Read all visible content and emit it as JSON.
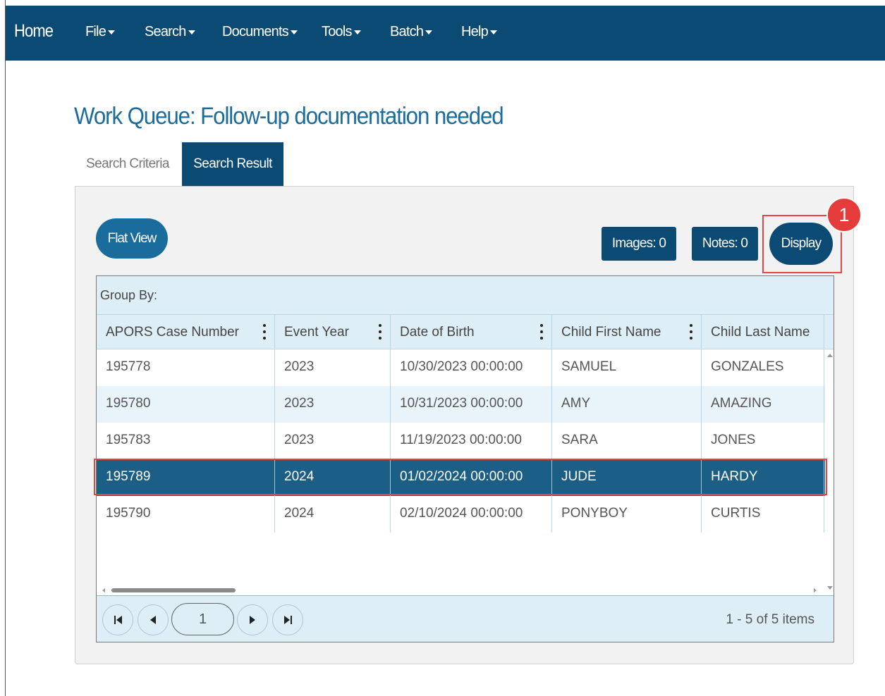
{
  "nav": {
    "home": "Home",
    "items": [
      "File",
      "Search",
      "Documents",
      "Tools",
      "Batch",
      "Help"
    ]
  },
  "page": {
    "title": "Work Queue: Follow-up documentation needed"
  },
  "tabs": [
    "Search Criteria",
    "Search Result"
  ],
  "toolbar": {
    "flat_view": "Flat View",
    "images": "Images: 0",
    "notes": "Notes: 0",
    "display": "Display",
    "callout": "1"
  },
  "grid": {
    "group_by": "Group By:",
    "columns": [
      "APORS Case Number",
      "Event Year",
      "Date of Birth",
      "Child First Name",
      "Child Last Name"
    ],
    "rows": [
      [
        "195778",
        "2023",
        "10/30/2023 00:00:00",
        "SAMUEL",
        "GONZALES"
      ],
      [
        "195780",
        "2023",
        "10/31/2023 00:00:00",
        "AMY",
        "AMAZING"
      ],
      [
        "195783",
        "2023",
        "11/19/2023 00:00:00",
        "SARA",
        "JONES"
      ],
      [
        "195789",
        "2024",
        "01/02/2024 00:00:00",
        "JUDE",
        "HARDY"
      ],
      [
        "195790",
        "2024",
        "02/10/2024 00:00:00",
        "PONYBOY",
        "CURTIS"
      ]
    ],
    "selected_row": 3
  },
  "pager": {
    "current_page": "1",
    "info": "1 - 5 of 5 items"
  },
  "colors": {
    "nav_bg": "#0b4a72",
    "title": "#1a6c9c",
    "selected_row": "#1b5f86",
    "highlight": "#e04848"
  }
}
